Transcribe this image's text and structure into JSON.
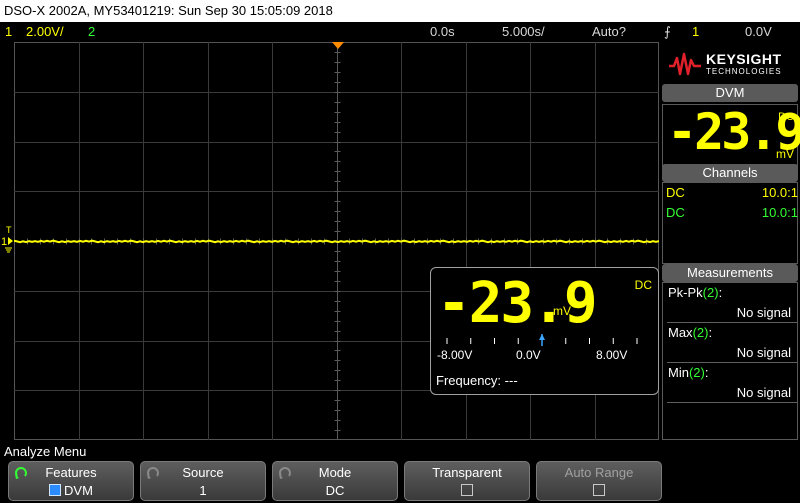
{
  "window": {
    "title": "DSO-X 2002A, MY53401219: Sun Sep 30 15:05:09 2018"
  },
  "status": {
    "ch1_num": "1",
    "ch1_scale": "2.00V/",
    "ch2_num": "2",
    "time_delay": "0.0s",
    "time_scale": "5.000s/",
    "trigger_mode": "Auto?",
    "trigger_source": "1",
    "trigger_level": "0.0V"
  },
  "colors": {
    "ch1": "#ffff00",
    "ch2": "#33ff33",
    "panel": "#5a5a5a",
    "brand_red": "#e0202a"
  },
  "brand": {
    "name": "KEYSIGHT",
    "sub": "TECHNOLOGIES"
  },
  "dvm_panel": {
    "header": "DVM",
    "value": "-23.9",
    "unit": "mV",
    "coupling": "DC"
  },
  "channels_panel": {
    "header": "Channels",
    "rows": [
      {
        "coupling": "DC",
        "probe": "10.0:1",
        "color": "#ffff00"
      },
      {
        "coupling": "DC",
        "probe": "10.0:1",
        "color": "#33ff33"
      }
    ]
  },
  "measurements_panel": {
    "header": "Measurements",
    "items": [
      {
        "label": "Pk-Pk",
        "source": "(2)",
        "suffix": ":",
        "value": "No signal"
      },
      {
        "label": "Max",
        "source": "(2)",
        "suffix": ":",
        "value": "No signal"
      },
      {
        "label": "Min",
        "source": "(2)",
        "suffix": ":",
        "value": "No signal"
      }
    ]
  },
  "dvm_overlay": {
    "value": "-23.9",
    "unit": "mV",
    "coupling": "DC",
    "scale_min": "-8.00V",
    "scale_mid": "0.0V",
    "scale_max": "8.00V",
    "marker_fraction": 0.5,
    "frequency_label": "Frequency:",
    "frequency_value": "---"
  },
  "trace": {
    "level_divisions": 0,
    "marker": "1"
  },
  "menu": {
    "title": "Analyze Menu",
    "softkeys": [
      {
        "label": "Features",
        "value": "DVM",
        "checkbox": true,
        "checked": true,
        "rotary": true,
        "enabled": true
      },
      {
        "label": "Source",
        "value": "1",
        "value_color": "#ffff00",
        "rotary": true,
        "enabled": true
      },
      {
        "label": "Mode",
        "value": "DC",
        "rotary": true,
        "enabled": true
      },
      {
        "label": "Transparent",
        "value": "",
        "checkbox": true,
        "checked": false,
        "enabled": true
      },
      {
        "label": "Auto Range",
        "value": "",
        "checkbox": true,
        "checked": false,
        "enabled": false
      }
    ]
  }
}
